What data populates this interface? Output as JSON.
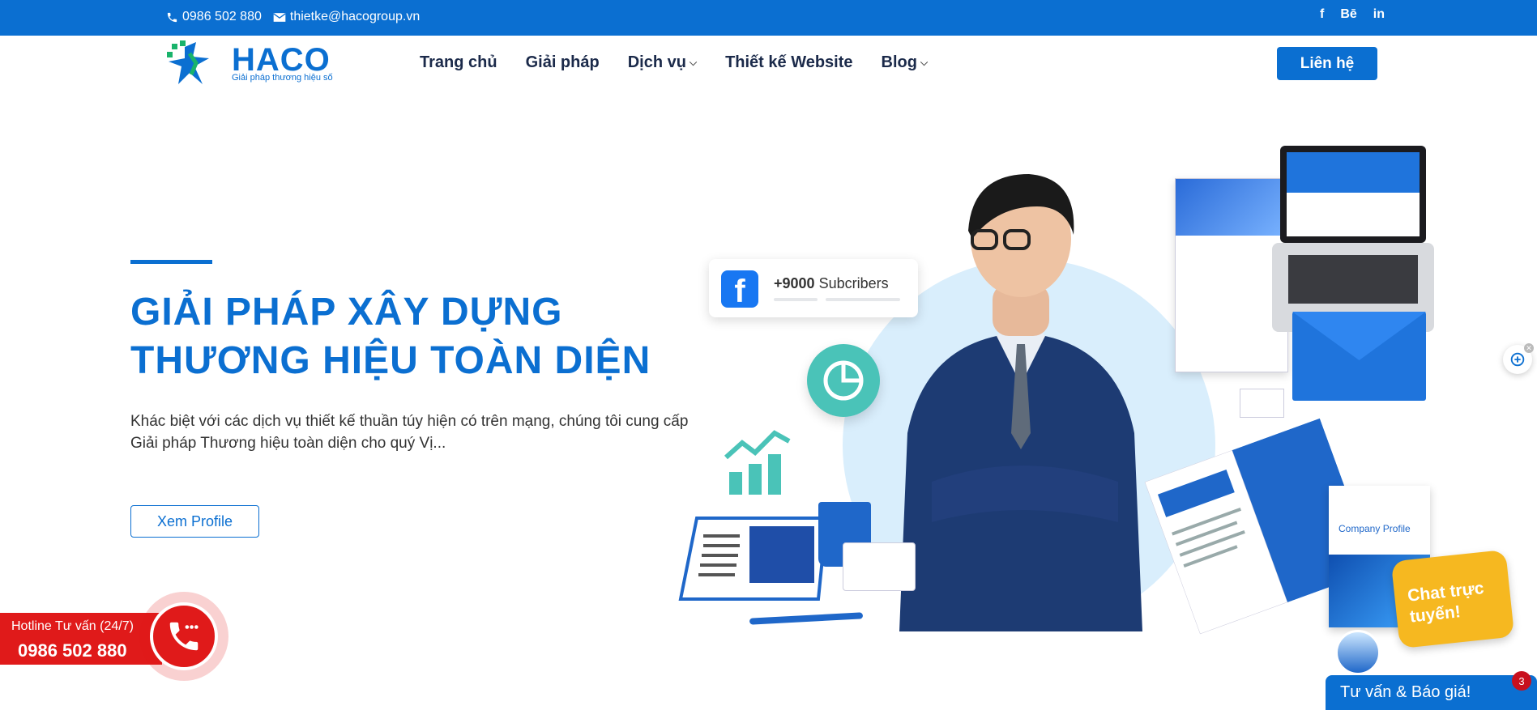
{
  "topbar": {
    "phone": "0986 502 880",
    "email": "thietke@hacogroup.vn",
    "social": {
      "facebook": "f",
      "behance": "Bē",
      "linkedin": "in"
    }
  },
  "header": {
    "logo_text": "HACO",
    "logo_tagline": "Giải pháp thương hiệu số",
    "nav": [
      "Trang chủ",
      "Giải pháp",
      "Dịch vụ",
      "Thiết kế Website",
      "Blog"
    ],
    "cta_label": "Liên hệ"
  },
  "hero": {
    "title_line1": "GIẢI PHÁP XÂY DỰNG",
    "title_line2": "THƯƠNG HIỆU TOÀN DIỆN",
    "description": "Khác biệt với các dịch vụ thiết kế thuần túy hiện có trên mạng, chúng tôi cung cấp Giải pháp Thương hiệu toàn diện cho quý Vị...",
    "button_label": "Xem Profile"
  },
  "illustration": {
    "fb_count": "+9000",
    "fb_label": "Subcribers",
    "company_profile_title": "Company Profile"
  },
  "hotline": {
    "label": "Hotline Tư vấn (24/7)",
    "phone": "0986 502 880"
  },
  "chat": {
    "bubble_text": "Chat trực tuyến!",
    "consult_label": "Tư vấn & Báo giá!",
    "unread_count": "3"
  },
  "colors": {
    "brand_blue": "#0b6fd1",
    "hotline_red": "#e01a1a",
    "chat_yellow": "#f6b820"
  }
}
